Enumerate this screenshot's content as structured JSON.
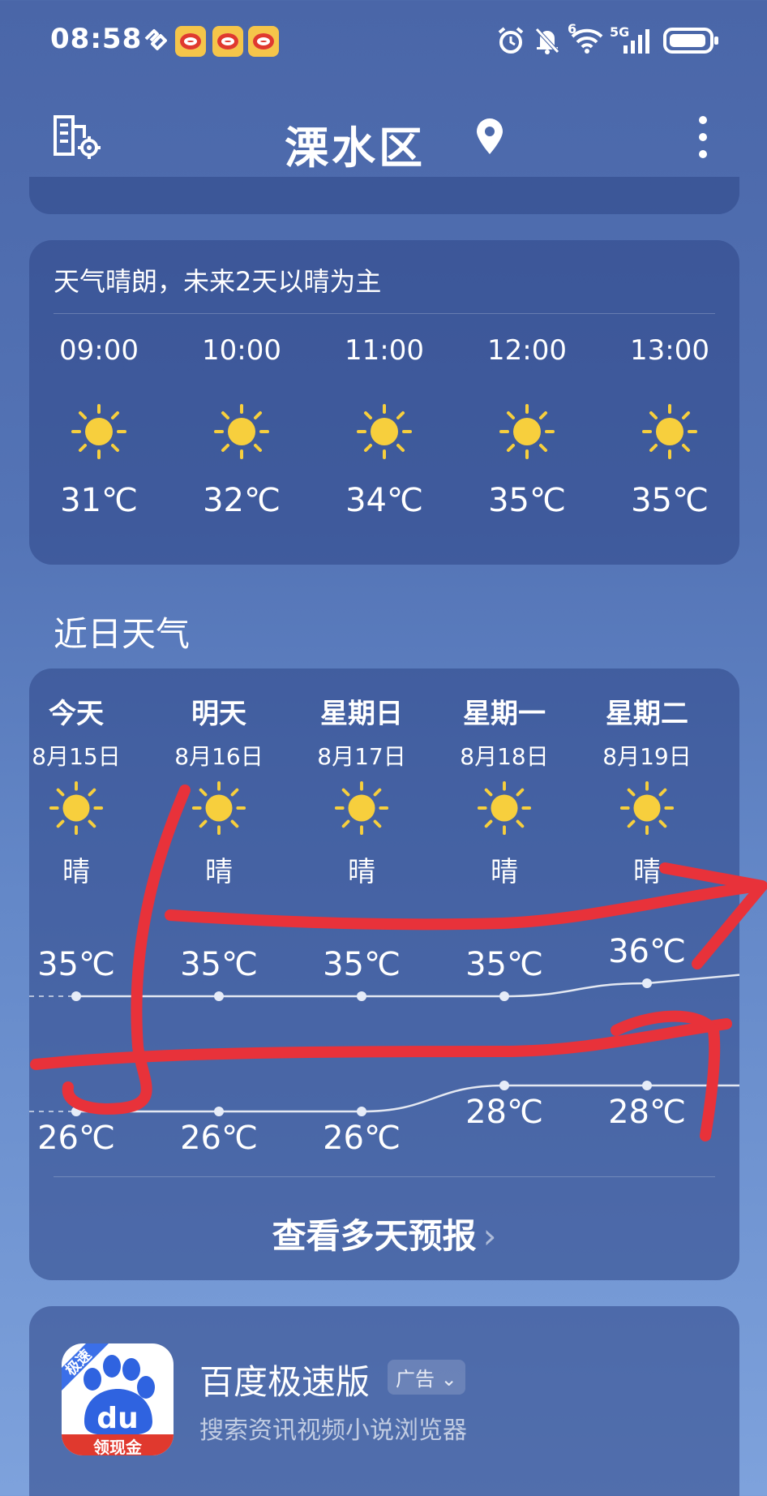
{
  "status_bar": {
    "time": "08:58",
    "network": "5G",
    "wifi_superscript": "6",
    "icons": [
      "heart-link-icon",
      "weibo-icon",
      "weibo-icon",
      "weibo-icon",
      "alarm-icon",
      "mute-icon",
      "wifi-icon",
      "signal-icon",
      "battery-icon"
    ]
  },
  "header": {
    "title": "溧水区",
    "left_icon": "city-settings-icon",
    "location_icon": "location-pin-icon",
    "menu_icon": "more-vertical-icon"
  },
  "hourly": {
    "summary": "天气晴朗，未来2天以晴为主",
    "items": [
      {
        "time": "09:00",
        "icon": "sun-icon",
        "temp": "31℃"
      },
      {
        "time": "10:00",
        "icon": "sun-icon",
        "temp": "32℃"
      },
      {
        "time": "11:00",
        "icon": "sun-icon",
        "temp": "34℃"
      },
      {
        "time": "12:00",
        "icon": "sun-icon",
        "temp": "35℃"
      },
      {
        "time": "13:00",
        "icon": "sun-icon",
        "temp": "35℃"
      }
    ]
  },
  "daily": {
    "section_title": "近日天气",
    "days": [
      {
        "name": "今天",
        "date": "8月15日",
        "icon": "sun-icon",
        "cond": "晴",
        "high": "35℃",
        "low": "26℃",
        "high_value": 35,
        "low_value": 26
      },
      {
        "name": "明天",
        "date": "8月16日",
        "icon": "sun-icon",
        "cond": "晴",
        "high": "35℃",
        "low": "26℃",
        "high_value": 35,
        "low_value": 26
      },
      {
        "name": "星期日",
        "date": "8月17日",
        "icon": "sun-icon",
        "cond": "晴",
        "high": "35℃",
        "low": "26℃",
        "high_value": 35,
        "low_value": 26
      },
      {
        "name": "星期一",
        "date": "8月18日",
        "icon": "sun-icon",
        "cond": "晴",
        "high": "35℃",
        "low": "28℃",
        "high_value": 35,
        "low_value": 28
      },
      {
        "name": "星期二",
        "date": "8月19日",
        "icon": "sun-icon",
        "cond": "晴",
        "high": "36℃",
        "low": "28℃",
        "high_value": 36,
        "low_value": 28
      }
    ],
    "more_label": "查看多天预报",
    "more_icon": "chevron-right-icon"
  },
  "ad": {
    "app_name": "百度极速版",
    "badge": "广告",
    "description": "搜索资讯视频小说浏览器",
    "icon_corner_text": "极速",
    "icon_text": "du",
    "icon_bottom_text": "领现金",
    "icon": "baidu-paw-icon"
  },
  "colors": {
    "background_top": "#4a66a8",
    "background_bottom": "#7ea2dc",
    "sun": "#f7cf3d",
    "annotation_red": "#e8323a",
    "baidu_blue": "#2f63e0",
    "baidu_red": "#e0392e"
  }
}
